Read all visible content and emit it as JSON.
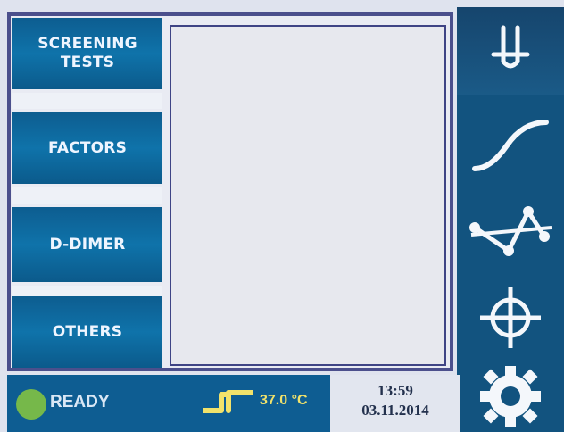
{
  "menu": {
    "items": [
      {
        "label_line1": "SCREENING",
        "label_line2": "TESTS"
      },
      {
        "label": "FACTORS"
      },
      {
        "label": "D-DIMER"
      },
      {
        "label": "OTHERS"
      }
    ]
  },
  "right_toolbar": {
    "icons": [
      "cuvette-icon",
      "curve-icon",
      "graph-icon",
      "crosshair-icon",
      "gear-icon"
    ]
  },
  "status": {
    "state": "READY",
    "temperature": "37.0 °C",
    "time": "13:59",
    "date": "03.11.2014"
  },
  "colors": {
    "menu_blue": "#0f73aa",
    "frame_border": "#4b4f8c",
    "ready_green": "#76b84a",
    "temperature_yellow": "#f1e26b",
    "right_panel_blue": "#12537f"
  }
}
